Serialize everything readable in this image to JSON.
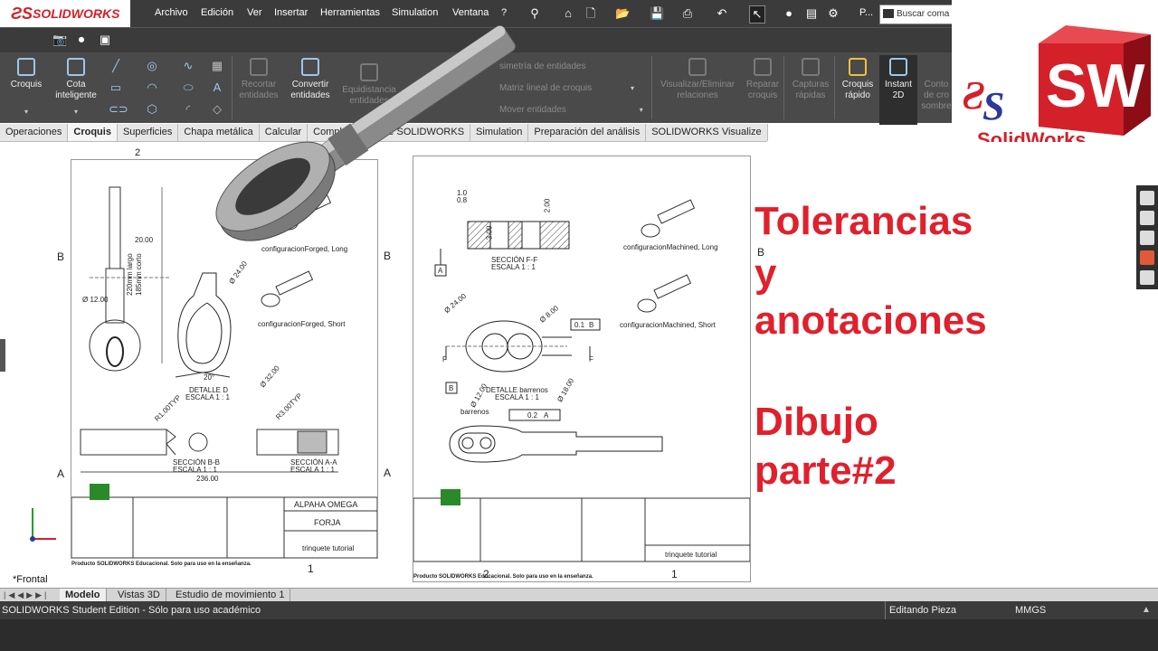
{
  "app": {
    "logo_text": "SOLIDWORKS"
  },
  "menu": [
    "Archivo",
    "Edición",
    "Ver",
    "Insertar",
    "Herramientas",
    "Simulation",
    "Ventana",
    "?"
  ],
  "search": {
    "placeholder": "Buscar coma"
  },
  "toolbar": {
    "p_label": "P..."
  },
  "ribbon": {
    "croquis": "Croquis",
    "cota": "Cota inteligente",
    "recortar": "Recortar entidades",
    "convertir": "Convertir entidades",
    "equidistancia": "Equidistancia entidades",
    "simetria": "simetría de entidades",
    "matriz": "Matriz lineal de croquis",
    "mover": "Mover entidades",
    "visualizar": "Visualizar/Eliminar relaciones",
    "reparar": "Reparar croquis",
    "capturas": "Capturas rápidas",
    "croquis_rapido": "Croquis rápido",
    "instant2d": "Instant 2D",
    "contorno": "Conto de cro sombre"
  },
  "tabs": [
    "Operaciones",
    "Croquis",
    "Superficies",
    "Chapa metálica",
    "Calcular",
    "Complementos de SOLIDWORKS",
    "Simulation",
    "Preparación del análisis",
    "SOLIDWORKS Visualize"
  ],
  "brand": {
    "logo_text": "SolidWorks",
    "letters": "SW"
  },
  "overlay": {
    "line1": "Tolerancias",
    "line2": "y",
    "line3": "anotaciones",
    "line4": "Dibujo",
    "line5": "parte#2"
  },
  "sheet1": {
    "zone_2": "2",
    "zone_1": "1",
    "zone_b": "B",
    "zone_a": "A",
    "config_long": "configuracionForged, Long",
    "config_short": "configuracionForged, Short",
    "detalle_d": "DETALLE D",
    "escala": "ESCALA 1 : 1",
    "seccion_bb": "SECCIÓN B-B",
    "seccion_aa": "SECCIÓN A-A",
    "dim_20": "20.00",
    "dim_12": "Ø 12.00",
    "dim_220": "220mm largo",
    "dim_185": "185mm corto",
    "dim_24": "Ø 24.00",
    "dim_32": "Ø 32.00",
    "dim_20deg": "20°",
    "dim_236": "236.00",
    "r1": "R1.00TYP",
    "r3": "R3.00TYP",
    "title_company": "ALPAHA OMEGA",
    "title_part": "FORJA",
    "title_dwg": "trinquete tutorial",
    "edu_note": "Producto SOLIDWORKS Educacional. Solo para uso en la enseñanza."
  },
  "sheet2": {
    "config_long": "configuracionMachined, Long",
    "config_short": "configuracionMachined, Short",
    "seccion_ff": "SECCIÓN F-F",
    "escala": "ESCALA 1 : 1",
    "detalle_barrenos": "DETALLE barrenos",
    "barrenos": "barrenos",
    "tol_01": "0.1",
    "tol_02": "0.2",
    "datum_a": "A",
    "datum_b": "B",
    "dim_10": "1.0",
    "dim_08": "0.8",
    "dim_200": "2.00",
    "dim_300": "3.00",
    "dim_24": "Ø 24.00",
    "dim_8": "Ø 8.00",
    "dim_12": "Ø 12.00",
    "dim_18": "Ø 18.00",
    "cut_f": "F",
    "title_dwg": "trinquete tutorial",
    "edu_note": "Producto SOLIDWORKS Educacional. Solo para uso en la enseñanza."
  },
  "view_label": "*Frontal",
  "bottom_tabs": [
    "Modelo",
    "Vistas 3D",
    "Estudio de movimiento 1"
  ],
  "status": {
    "left": "SOLIDWORKS Student Edition - Sólo para uso académico",
    "editing": "Editando Pieza",
    "units": "MMGS"
  },
  "colors": {
    "accent_red": "#e0202c",
    "ui_dark": "#3b3b3b"
  }
}
